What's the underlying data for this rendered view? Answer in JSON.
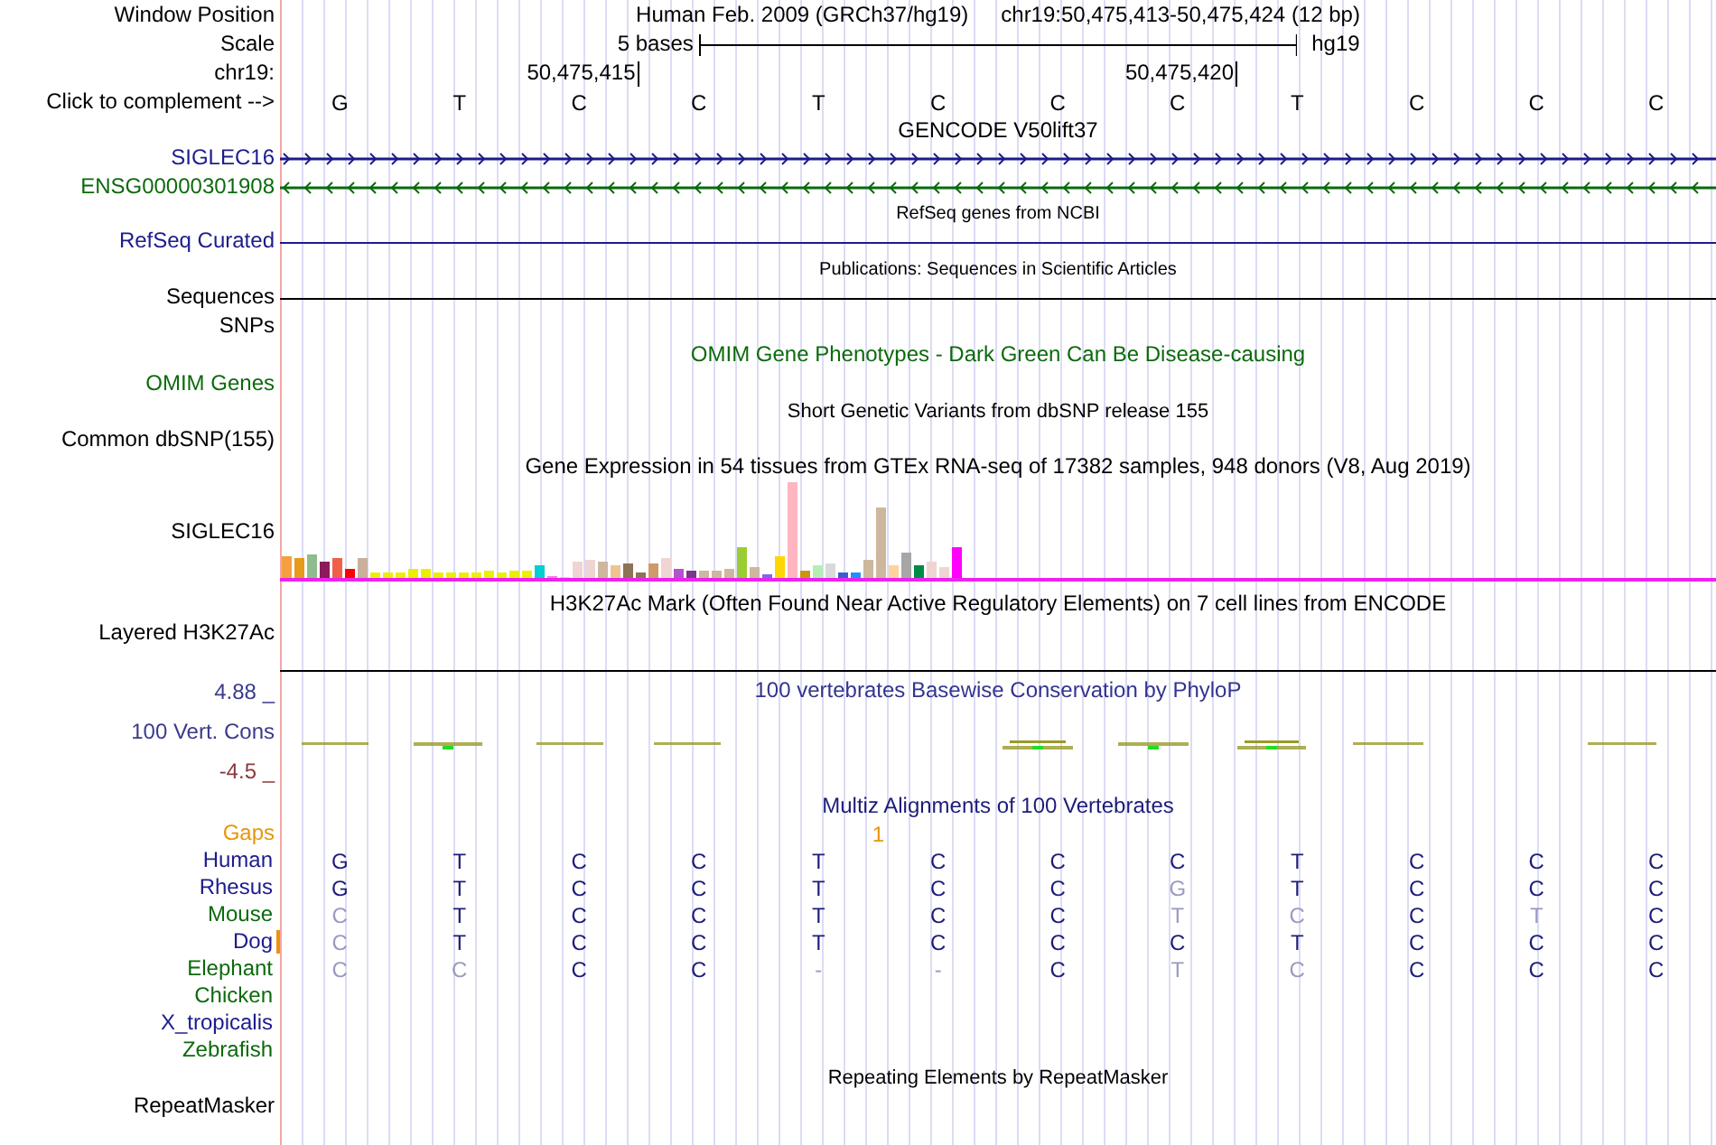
{
  "header": {
    "window_position_label": "Window Position",
    "assembly": "Human Feb. 2009 (GRCh37/hg19)",
    "position": "chr19:50,475,413-50,475,424 (12 bp)",
    "scale_label": "Scale",
    "scale_text": "5 bases",
    "scale_db": "hg19",
    "chrom_label": "chr19:",
    "ticks": [
      "50,475,415",
      "50,475,420"
    ],
    "complement_label": "Click to complement -->",
    "bases": [
      "G",
      "T",
      "C",
      "C",
      "T",
      "C",
      "C",
      "C",
      "T",
      "C",
      "C",
      "C"
    ]
  },
  "tracks": [
    {
      "kind": "gene",
      "title": "GENCODE V50lift37",
      "genes": [
        {
          "label": "SIGLEC16",
          "kind": "forward",
          "color": "#1c1c8c"
        },
        {
          "label": "ENSG00000301908",
          "kind": "reverse",
          "color": "#0c6a0c"
        }
      ]
    },
    {
      "kind": "line",
      "title": "RefSeq genes from NCBI",
      "label": "RefSeq Curated",
      "color": "#1c1c8c"
    },
    {
      "kind": "line",
      "title": "Publications: Sequences in Scientific Articles",
      "label": "Sequences",
      "color": "#000000"
    },
    {
      "kind": "empty",
      "label": "SNPs"
    },
    {
      "kind": "titled",
      "title": "OMIM Gene Phenotypes - Dark Green Can Be Disease-causing",
      "label": "OMIM Genes",
      "color": "#0c6a0c"
    },
    {
      "kind": "titled",
      "title": "Short Genetic Variants from dbSNP release 155",
      "label": "Common dbSNP(155)",
      "color": "#000000"
    },
    {
      "kind": "expression",
      "title": "Gene Expression in 54 tissues from GTEx RNA-seq of 17382 samples, 948 donors (V8, Aug 2019)",
      "label": "SIGLEC16"
    },
    {
      "kind": "layered",
      "title": "H3K27Ac Mark (Often Found Near Active Regulatory Elements) on 7 cell lines from ENCODE",
      "label": "Layered H3K27Ac"
    },
    {
      "kind": "phylop",
      "title": "100 vertebrates Basewise Conservation by PhyloP",
      "label": "100 Vert. Cons",
      "max": "4.88 _",
      "min": "-4.5 _"
    },
    {
      "kind": "multiz",
      "title": "Multiz Alignments of 100 Vertebrates",
      "gaps_label": "Gaps",
      "gap_count": "1",
      "species": [
        {
          "name": "Human",
          "color": "#1c1c8c",
          "gap_mark": false,
          "bases": [
            {
              "base": "G",
              "match": true
            },
            {
              "base": "T",
              "match": true
            },
            {
              "base": "C",
              "match": true
            },
            {
              "base": "C",
              "match": true
            },
            {
              "base": "T",
              "match": true
            },
            {
              "base": "C",
              "match": true
            },
            {
              "base": "C",
              "match": true
            },
            {
              "base": "C",
              "match": true
            },
            {
              "base": "T",
              "match": true
            },
            {
              "base": "C",
              "match": true
            },
            {
              "base": "C",
              "match": true
            },
            {
              "base": "C",
              "match": true
            }
          ]
        },
        {
          "name": "Rhesus",
          "color": "#1c1c8c",
          "gap_mark": false,
          "bases": [
            {
              "base": "G",
              "match": true
            },
            {
              "base": "T",
              "match": true
            },
            {
              "base": "C",
              "match": true
            },
            {
              "base": "C",
              "match": true
            },
            {
              "base": "T",
              "match": true
            },
            {
              "base": "C",
              "match": true
            },
            {
              "base": "C",
              "match": true
            },
            {
              "base": "G",
              "match": false
            },
            {
              "base": "T",
              "match": true
            },
            {
              "base": "C",
              "match": true
            },
            {
              "base": "C",
              "match": true
            },
            {
              "base": "C",
              "match": true
            }
          ]
        },
        {
          "name": "Mouse",
          "color": "#0c6a0c",
          "gap_mark": false,
          "bases": [
            {
              "base": "C",
              "match": false
            },
            {
              "base": "T",
              "match": true
            },
            {
              "base": "C",
              "match": true
            },
            {
              "base": "C",
              "match": true
            },
            {
              "base": "T",
              "match": true
            },
            {
              "base": "C",
              "match": true
            },
            {
              "base": "C",
              "match": true
            },
            {
              "base": "T",
              "match": false
            },
            {
              "base": "C",
              "match": false
            },
            {
              "base": "C",
              "match": true
            },
            {
              "base": "T",
              "match": false
            },
            {
              "base": "C",
              "match": true
            }
          ]
        },
        {
          "name": "Dog",
          "color": "#1c1c8c",
          "gap_mark": true,
          "bases": [
            {
              "base": "C",
              "match": false
            },
            {
              "base": "T",
              "match": true
            },
            {
              "base": "C",
              "match": true
            },
            {
              "base": "C",
              "match": true
            },
            {
              "base": "T",
              "match": true
            },
            {
              "base": "C",
              "match": true
            },
            {
              "base": "C",
              "match": true
            },
            {
              "base": "C",
              "match": true
            },
            {
              "base": "T",
              "match": true
            },
            {
              "base": "C",
              "match": true
            },
            {
              "base": "C",
              "match": true
            },
            {
              "base": "C",
              "match": true
            }
          ]
        },
        {
          "name": "Elephant",
          "color": "#0c6a0c",
          "gap_mark": false,
          "bases": [
            {
              "base": "C",
              "match": false
            },
            {
              "base": "C",
              "match": false
            },
            {
              "base": "C",
              "match": true
            },
            {
              "base": "C",
              "match": true
            },
            {
              "base": "-",
              "match": false
            },
            {
              "base": "-",
              "match": false
            },
            {
              "base": "C",
              "match": true
            },
            {
              "base": "T",
              "match": false
            },
            {
              "base": "C",
              "match": false
            },
            {
              "base": "C",
              "match": true
            },
            {
              "base": "C",
              "match": true
            },
            {
              "base": "C",
              "match": true
            }
          ]
        },
        {
          "name": "Chicken",
          "color": "#0c6a0c",
          "gap_mark": false
        },
        {
          "name": "X_tropicalis",
          "color": "#1c1c8c",
          "gap_mark": false
        },
        {
          "name": "Zebrafish",
          "color": "#0c6a0c",
          "gap_mark": false
        }
      ]
    },
    {
      "kind": "titled",
      "title": "Repeating Elements by RepeatMasker",
      "label": "RepeatMasker",
      "color": "#000000"
    }
  ]
}
